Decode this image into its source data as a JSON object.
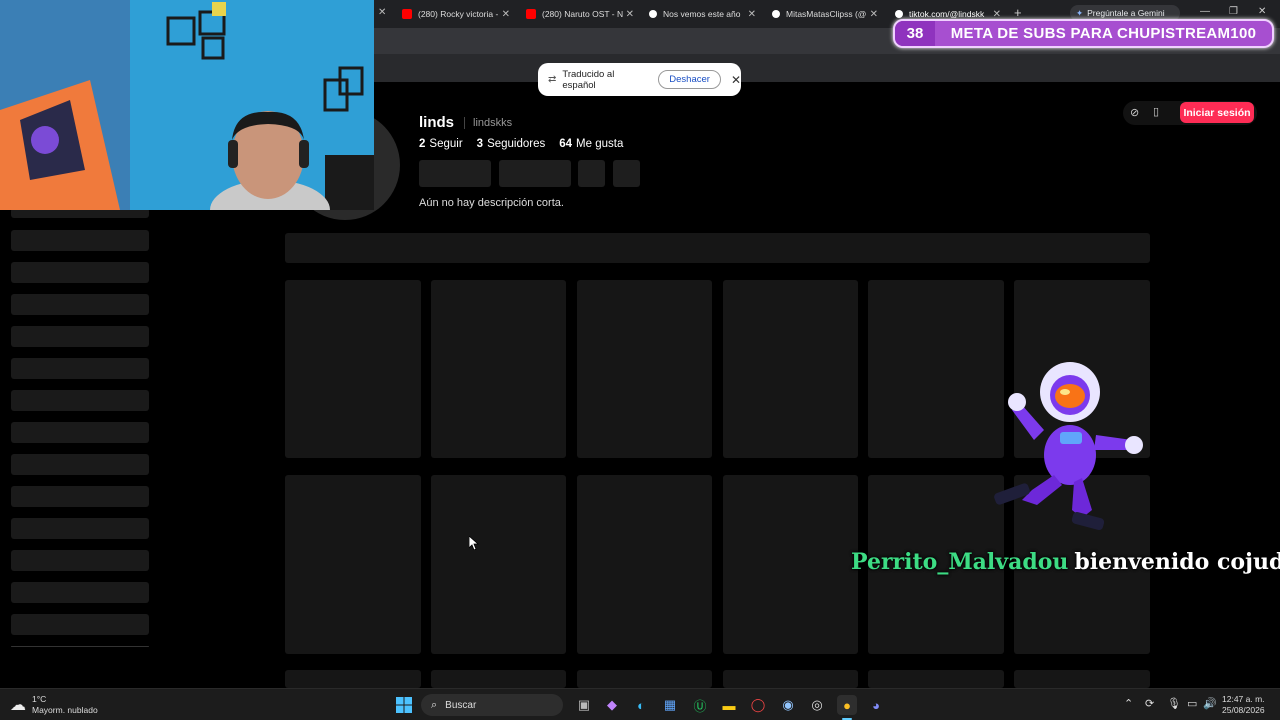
{
  "browser": {
    "tabs": [
      {
        "label": "(280) Rocky victoria -",
        "favicon_color": "#ff0000"
      },
      {
        "label": "(280) Naruto OST - N",
        "favicon_color": "#ff0000"
      },
      {
        "label": "Nos vemos este año",
        "favicon_color": "#ffffff"
      },
      {
        "label": "MitasMatasClipss (@",
        "favicon_color": "#ffffff"
      },
      {
        "label": "tiktok.com/@lindskk",
        "favicon_color": "#ffffff"
      }
    ],
    "new_tab": "+",
    "gemini_label": "Pregúntale a Gemini"
  },
  "overlay": {
    "meta_count": "38",
    "meta_text": "META DE SUBS PARA CHUPISTREAM100",
    "chat_user": "Perrito_Malvadou",
    "chat_message": "bienvenido cojudito!"
  },
  "translate_popup": {
    "text": "Traducido al español",
    "undo_label": "Deshacer"
  },
  "profile": {
    "display_name": "linds",
    "handle": "lindskks",
    "following_count": "2",
    "following_label": "Seguir",
    "followers_count": "3",
    "followers_label": "Seguidores",
    "likes_count": "64",
    "likes_label": "Me gusta",
    "description": "Aún no hay descripción corta.",
    "login_label": "Iniciar sesión"
  },
  "taskbar": {
    "temperature": "1°C",
    "weather": "Mayorm. nublado",
    "search_placeholder": "Buscar",
    "time": "12:47 a. m.",
    "date": "25/08/2026"
  },
  "colors": {
    "tiktok_accent": "#fe2c55",
    "meta_purple": "#a74fd0",
    "chat_user_green": "#3ddc84"
  }
}
